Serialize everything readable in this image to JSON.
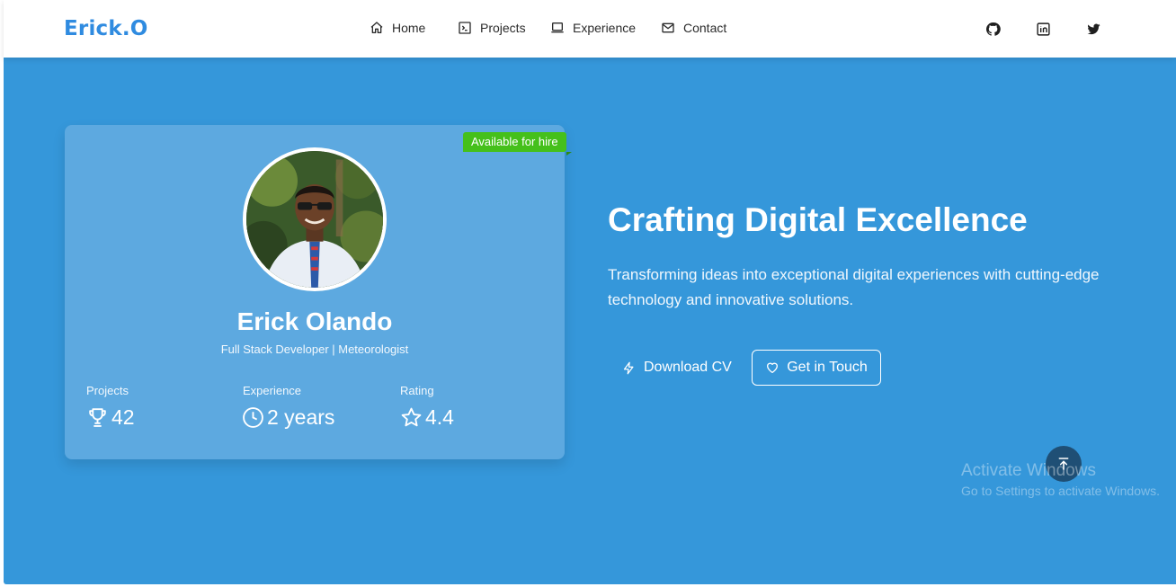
{
  "navbar": {
    "brand": "Erick.O",
    "links": [
      {
        "label": "Home",
        "icon": "home-icon"
      },
      {
        "label": "Projects",
        "icon": "terminal-icon"
      },
      {
        "label": "Experience",
        "icon": "laptop-icon"
      },
      {
        "label": "Contact",
        "icon": "mail-icon"
      }
    ],
    "social": [
      "github-icon",
      "linkedin-icon",
      "twitter-icon"
    ]
  },
  "profile": {
    "badge": "Available for hire",
    "name": "Erick Olando",
    "role": "Full Stack Developer | Meteorologist",
    "stats": [
      {
        "label": "Projects",
        "value": "42",
        "icon": "trophy-icon"
      },
      {
        "label": "Experience",
        "value": "2 years",
        "icon": "clock-icon"
      },
      {
        "label": "Rating",
        "value": "4.4",
        "icon": "star-icon"
      }
    ]
  },
  "hero": {
    "headline": "Crafting Digital Excellence",
    "subtext": "Transforming ideas into exceptional digital experiences with cutting-edge technology and innovative solutions.",
    "download_label": "Download CV",
    "touch_label": "Get in Touch"
  },
  "watermark": {
    "title": "Activate Windows",
    "subtitle": "Go to Settings to activate Windows."
  },
  "colors": {
    "brand": "#2f8be0",
    "hero_bg": "#3597da",
    "card_bg": "#5da9e0",
    "badge": "#45c01b",
    "scroll_button": "#1f4f75"
  }
}
